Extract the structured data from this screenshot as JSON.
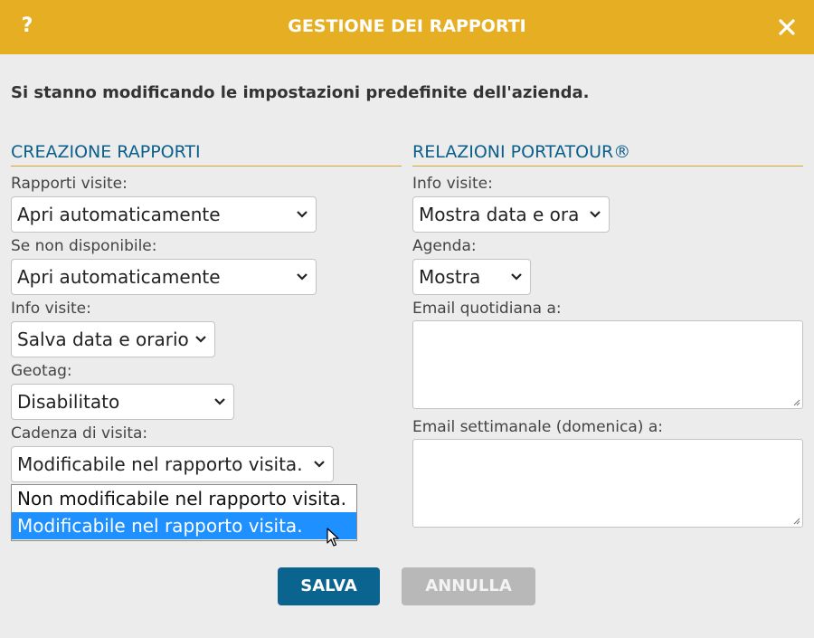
{
  "dialog": {
    "title": "GESTIONE DEI RAPPORTI",
    "help_label": "?",
    "close_icon": "close-icon"
  },
  "notice": "Si stanno modificando le impostazioni predefinite dell'azienda.",
  "left": {
    "heading": "CREAZIONE RAPPORTI",
    "fields": [
      {
        "label": "Rapporti visite:",
        "value": "Apri automaticamente"
      },
      {
        "label": "Se non disponibile:",
        "value": "Apri automaticamente"
      },
      {
        "label": "Info visite:",
        "value": "Salva data e orario"
      },
      {
        "label": "Geotag:",
        "value": "Disabilitato"
      },
      {
        "label": "Cadenza di visita:",
        "value": "Modificabile nel rapporto visita."
      }
    ],
    "cadence_options": [
      "Non modificabile nel rapporto visita.",
      "Modificabile nel rapporto visita."
    ]
  },
  "right": {
    "heading": "RELAZIONI PORTATOUR®",
    "info_label": "Info visite:",
    "info_value": "Mostra data e ora",
    "agenda_label": "Agenda:",
    "agenda_value": "Mostra",
    "daily_label": "Email quotidiana a:",
    "daily_value": "",
    "weekly_label": "Email settimanale (domenica) a:",
    "weekly_value": ""
  },
  "buttons": {
    "save": "SALVA",
    "cancel": "ANNULLA"
  },
  "colors": {
    "titlebar": "#e6ae22",
    "heading": "#0b5f8c",
    "save": "#0b6390",
    "cancel": "#b8b8b8",
    "highlight": "#1e90ff"
  }
}
